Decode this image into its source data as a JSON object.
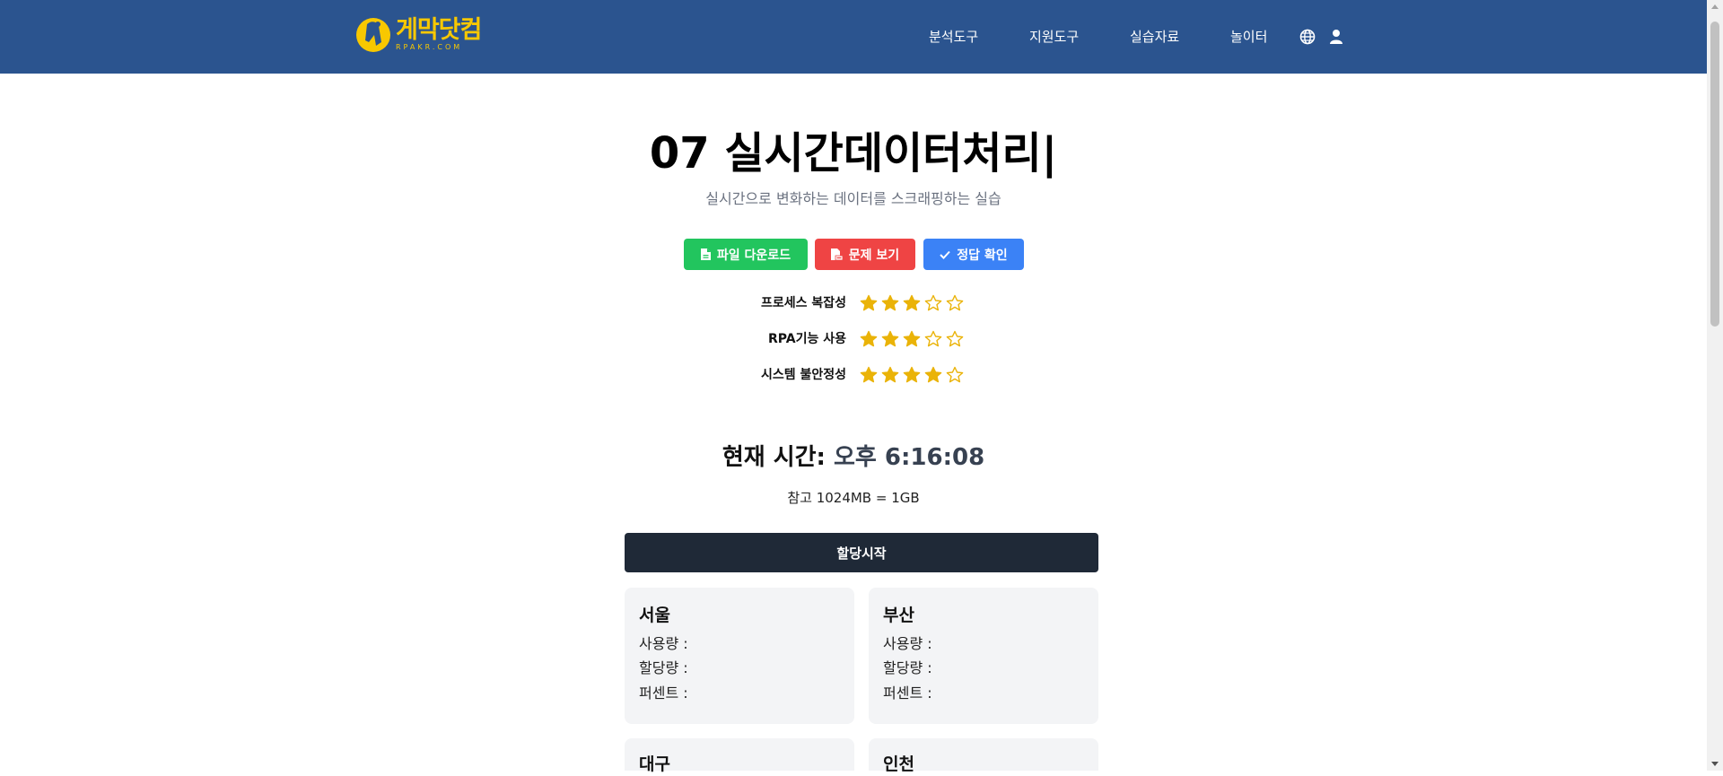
{
  "nav": {
    "logo_text": "게막닷컴",
    "logo_sub": "RPAKR.COM",
    "items": [
      "분석도구",
      "지원도구",
      "실습자료",
      "놀이터"
    ]
  },
  "page": {
    "title": "07 실시간데이터처리|",
    "subtitle": "실시간으로 변화하는 데이터를 스크래핑하는 실습"
  },
  "buttons": {
    "download": "파일 다운로드",
    "problem": "문제 보기",
    "answer": "정답 확인"
  },
  "ratings": [
    {
      "label": "프로세스 복잡성",
      "stars": 3,
      "max": 5
    },
    {
      "label": "RPA기능 사용",
      "stars": 3,
      "max": 5
    },
    {
      "label": "시스템 불안정성",
      "stars": 4,
      "max": 5
    }
  ],
  "clock": {
    "label": "현재 시간:",
    "value": "오후 6:16:08"
  },
  "note": "참고 1024MB = 1GB",
  "start_button": "할당시작",
  "cards": [
    {
      "name": "서울",
      "usage": "사용량 :",
      "alloc": "할당량 :",
      "percent": "퍼센트 :"
    },
    {
      "name": "부산",
      "usage": "사용량 :",
      "alloc": "할당량 :",
      "percent": "퍼센트 :"
    },
    {
      "name": "대구"
    },
    {
      "name": "인천"
    }
  ],
  "colors": {
    "nav_bg": "#2b548f",
    "logo": "#f8c800",
    "download": "#22c55e",
    "problem": "#ef4444",
    "answer": "#3b82f6",
    "star": "#eab308",
    "start_btn": "#1f2937",
    "card_bg": "#f3f4f6"
  }
}
